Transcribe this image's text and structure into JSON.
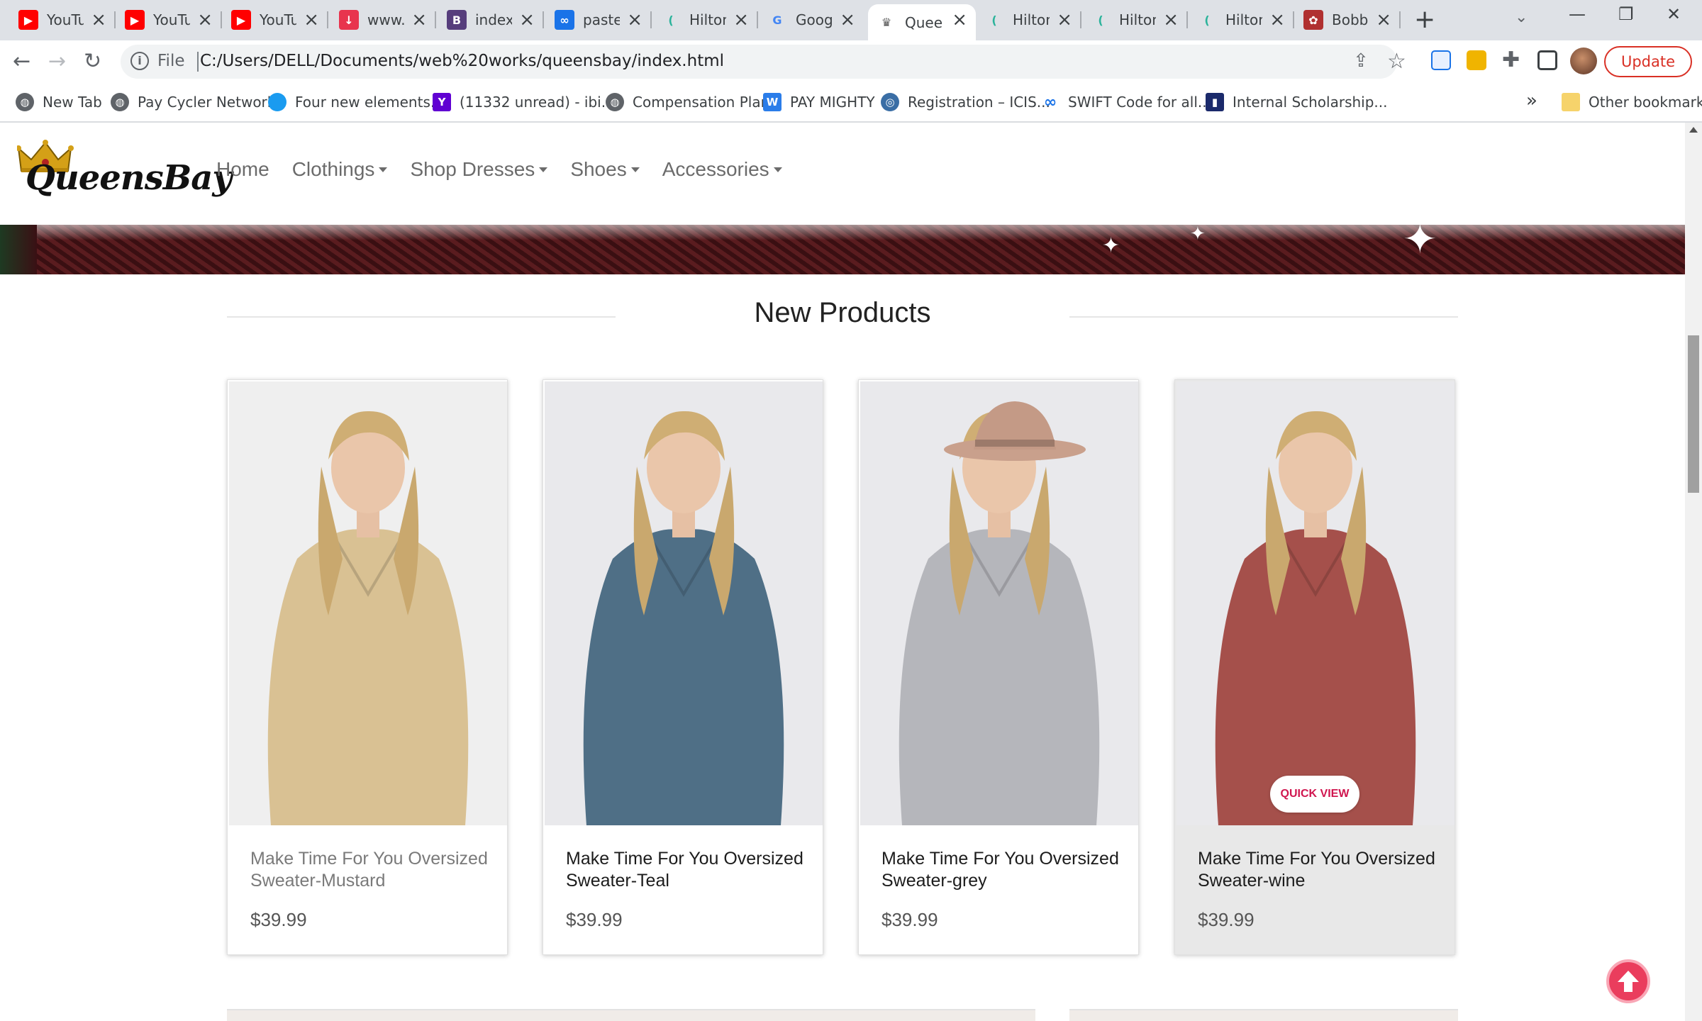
{
  "browser": {
    "tabs": [
      {
        "title": "YouTube",
        "icon": "youtube-icon",
        "color": "#ff0000"
      },
      {
        "title": "YouTube",
        "icon": "youtube-icon",
        "color": "#ff0000"
      },
      {
        "title": "YouTube",
        "icon": "youtube-icon",
        "color": "#ff0000"
      },
      {
        "title": "www.y",
        "icon": "download-icon",
        "color": "#e8344e"
      },
      {
        "title": "index",
        "icon": "bootstrap-icon",
        "color": "#563d7c"
      },
      {
        "title": "pastec",
        "icon": "link-icon",
        "color": "#1a73e8"
      },
      {
        "title": "Hilton",
        "icon": "hilton-icon",
        "color": "#2bb39b"
      },
      {
        "title": "Google",
        "icon": "google-icon",
        "color": "#4285f4"
      },
      {
        "title": "Queen",
        "icon": "queensbay-icon",
        "color": "#555555"
      },
      {
        "title": "Hilton",
        "icon": "hilton-icon",
        "color": "#2bb39b"
      },
      {
        "title": "Hilton",
        "icon": "hilton-icon",
        "color": "#2bb39b"
      },
      {
        "title": "Hilton",
        "icon": "hilton-icon",
        "color": "#2bb39b"
      },
      {
        "title": "Bobby",
        "icon": "gear-icon",
        "color": "#b03030"
      }
    ],
    "active_tab_index": 8,
    "address": {
      "scheme": "File",
      "url": "C:/Users/DELL/Documents/web%20works/queensbay/index.html"
    },
    "update_label": "Update",
    "bookmarks": [
      {
        "label": "New Tab",
        "icon": "globe-icon"
      },
      {
        "label": "Pay Cycler Network",
        "icon": "globe-icon"
      },
      {
        "label": "Four new elements...",
        "icon": "blue-dot-icon"
      },
      {
        "label": "(11332 unread) - ibi...",
        "icon": "yahoo-icon"
      },
      {
        "label": "Compensation Plan",
        "icon": "globe-icon"
      },
      {
        "label": "PAY MIGHTY",
        "icon": "w-icon"
      },
      {
        "label": "Registration – ICIS...",
        "icon": "icis-icon"
      },
      {
        "label": "SWIFT Code for all...",
        "icon": "infinity-icon"
      },
      {
        "label": "Internal Scholarship...",
        "icon": "scholarship-icon"
      }
    ],
    "other_bookmarks": "Other bookmarks",
    "bookmarks_overflow": "»"
  },
  "site": {
    "logo_text": "QueensBay",
    "nav": [
      {
        "label": "Home",
        "dropdown": false
      },
      {
        "label": "Clothings",
        "dropdown": true
      },
      {
        "label": "Shop Dresses",
        "dropdown": true
      },
      {
        "label": "Shoes",
        "dropdown": true
      },
      {
        "label": "Accessories",
        "dropdown": true
      }
    ],
    "section_title": "New Products",
    "products": [
      {
        "name": "Make Time For You Oversized Sweater-Mustard",
        "price": "$39.99",
        "sweater_color": "#d9c193",
        "hover": false
      },
      {
        "name": "Make Time For You Oversized Sweater-Teal",
        "price": "$39.99",
        "sweater_color": "#4f6f86",
        "hover": false
      },
      {
        "name": "Make Time For You Oversized Sweater-grey",
        "price": "$39.99",
        "sweater_color": "#b5b6bb",
        "hover": false
      },
      {
        "name": "Make Time For You Oversized Sweater-wine",
        "price": "$39.99",
        "sweater_color": "#a5504b",
        "hover": true
      }
    ],
    "quick_view_label": "QUICK VIEW",
    "colors": {
      "accent": "#d0164f",
      "back_to_top": "#ea3d5d"
    }
  }
}
